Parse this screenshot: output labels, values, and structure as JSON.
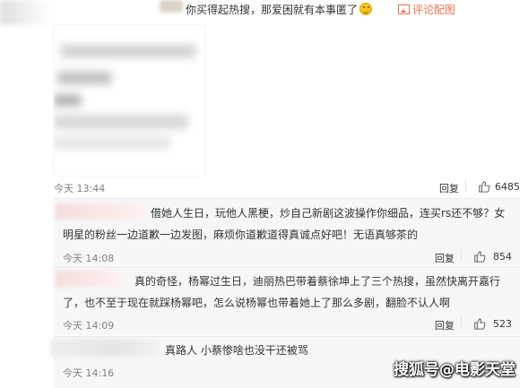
{
  "top_reply": {
    "text": "你买得起热搜，那爱困就有本事匿了",
    "emoji": "grin-emoji",
    "image_link": "评论配图"
  },
  "first_comment": {
    "time": "今天 13:44",
    "reply_label": "回复",
    "likes": "6485"
  },
  "sub_comments": [
    {
      "text_line1": "借她人生日，玩他人黑梗，炒自己新剧这波操作你细品，连买rs还不够？女",
      "text_line2": "明星的粉丝一边道歉一边发图，麻烦你道歉道得真诚点好吧！无语真够茶的",
      "time": "今天 14:08",
      "reply_label": "回复",
      "likes": "854"
    },
    {
      "text_line1": "真的奇怪，杨幂过生日，迪丽热巴带着蔡徐坤上了三个热搜，虽然快离开嘉行",
      "text_line2": "了，也不至于现在就踩杨幂吧，怎么说杨幂也带着她上了那么多剧，翻脸不认人啊",
      "time": "今天 14:09",
      "reply_label": "回复",
      "likes": "523"
    },
    {
      "text_line1": "真路人 小蔡惨啥也没干还被骂",
      "time": "今天 14:16"
    }
  ],
  "watermark": "搜狐号@电影天堂",
  "colors": {
    "link": "#eb7350",
    "meta": "#808080",
    "sub_bg": "#f7f7f7"
  }
}
